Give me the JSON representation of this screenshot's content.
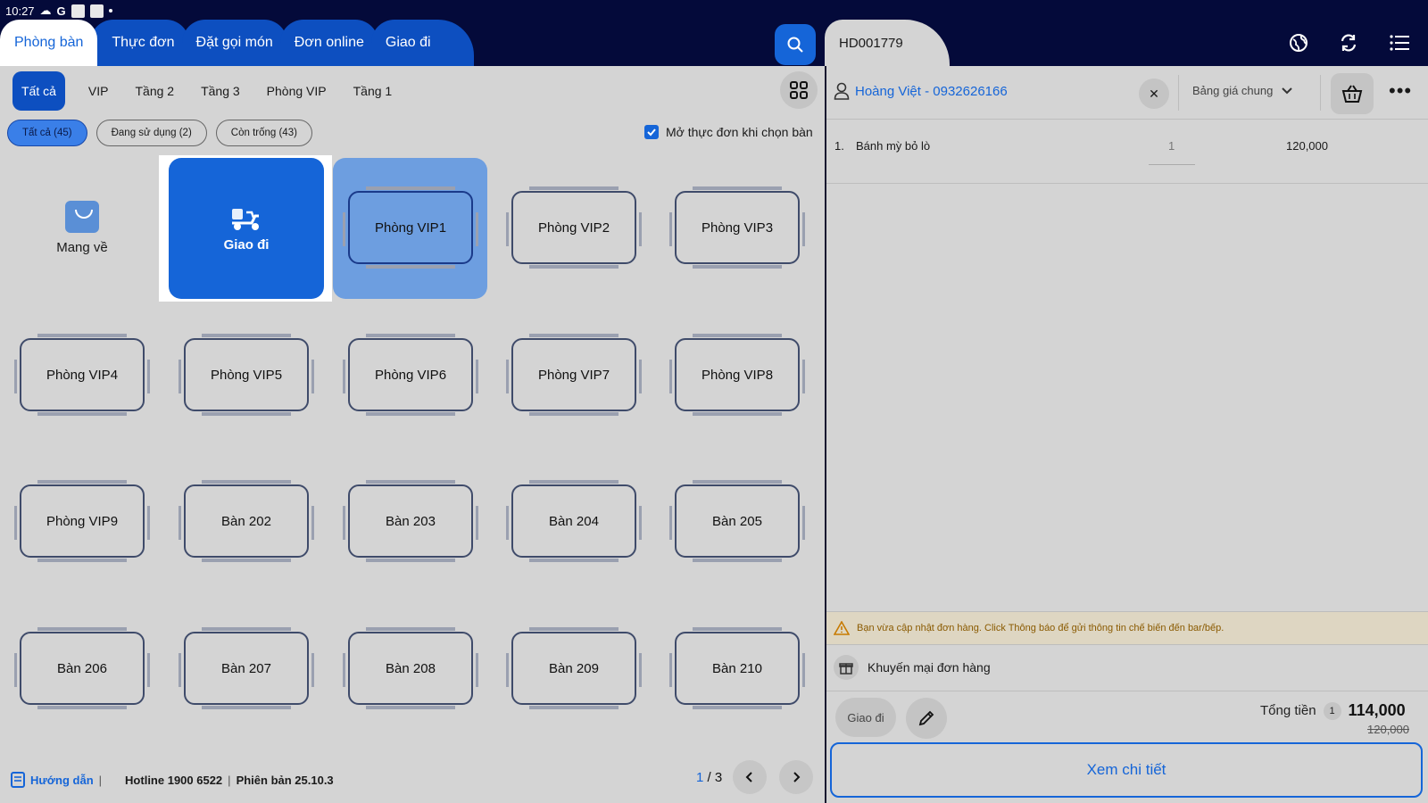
{
  "status_bar": {
    "time": "10:27",
    "g_label": "G"
  },
  "tabs": [
    {
      "label": "Phòng bàn"
    },
    {
      "label": "Thực đơn"
    },
    {
      "label": "Đặt gọi món"
    },
    {
      "label": "Đơn online"
    },
    {
      "label": "Giao đi"
    }
  ],
  "order": {
    "code": "HD001779"
  },
  "areas": [
    "Tất cả",
    "VIP",
    "Tầng 2",
    "Tầng 3",
    "Phòng VIP",
    "Tầng 1"
  ],
  "filters": [
    "Tất cả (45)",
    "Đang sử dụng (2)",
    "Còn trống (43)"
  ],
  "open_menu_label": "Mở thực đơn khi chọn bàn",
  "special_tiles": {
    "takeaway": "Mang về",
    "delivery": "Giao đi"
  },
  "tables": [
    "Phòng VIP1",
    "Phòng VIP2",
    "Phòng VIP3",
    "Phòng VIP4",
    "Phòng VIP5",
    "Phòng VIP6",
    "Phòng VIP7",
    "Phòng VIP8",
    "Phòng VIP9",
    "Bàn 202",
    "Bàn 203",
    "Bàn 204",
    "Bàn 205",
    "Bàn 206",
    "Bàn 207",
    "Bàn 208",
    "Bàn 209",
    "Bàn 210"
  ],
  "footer": {
    "guide": "Hướng dẫn",
    "hotline": "Hotline 1900 6522",
    "version": "Phiên bản 25.10.3"
  },
  "pager": {
    "current": "1",
    "sep": "/",
    "total": "3"
  },
  "customer": {
    "name": "Hoàng Việt - 0932626166"
  },
  "price_list": "Bảng giá chung",
  "items": [
    {
      "no": "1.",
      "name": "Bánh mỳ bỏ lò",
      "qty": "1",
      "price": "120,000"
    }
  ],
  "warning": "Bạn vừa cập nhật đơn hàng. Click Thông báo để gửi thông tin chế biến đến bar/bếp.",
  "promo_label": "Khuyến mại đơn hàng",
  "ship_label": "Giao đi",
  "total": {
    "label": "Tổng tiền",
    "count": "1",
    "value": "114,000",
    "original": "120,000"
  },
  "detail_button": "Xem chi tiết",
  "colors": {
    "primary": "#1565d8",
    "topbar": "#040a3a",
    "panel": "#d4d4d4"
  }
}
